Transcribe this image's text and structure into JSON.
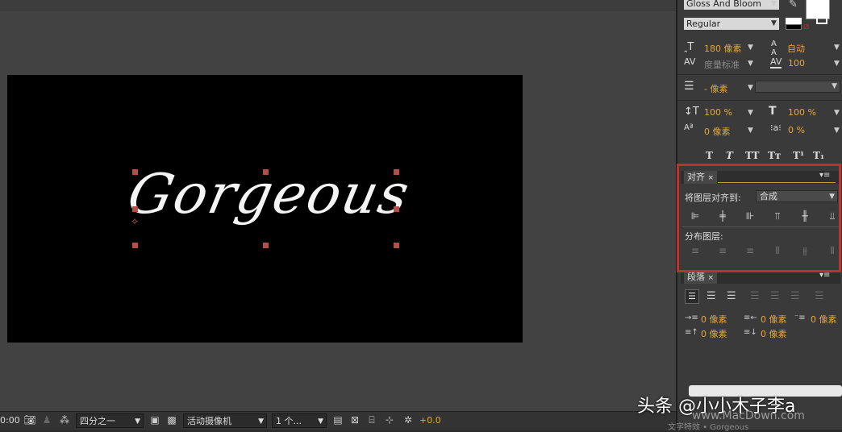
{
  "viewer": {
    "composition_text": "Gorgeous"
  },
  "bottombar": {
    "timecode": "0:00",
    "resolution": "四分之一",
    "camera": "活动摄像机",
    "views": "1 个...",
    "exposure": "+0.0"
  },
  "character": {
    "font_name": "Gloss And Bloom",
    "font_style": "Regular",
    "font_size": "180 像素",
    "leading": "自动",
    "kerning": "度量标准",
    "tracking": "100",
    "stroke_width": "- 像素",
    "vert_scale": "100 %",
    "horiz_scale": "100 %",
    "baseline_shift": "0 像素",
    "tsume": "0 %",
    "format_buttons": [
      "T",
      "T",
      "TT",
      "Tт",
      "T¹",
      "T₁"
    ]
  },
  "align_panel": {
    "tab_label": "对齐",
    "align_to_label": "将图层对齐到:",
    "align_to_value": "合成",
    "distribute_label": "分布图层:"
  },
  "paragraph_panel": {
    "tab_label": "段落",
    "indent_left": "0 像素",
    "indent_right": "0 像素",
    "indent_first": "0 像素",
    "space_before": "0 像素",
    "space_after": "0 像素"
  },
  "watermark": {
    "main": "头条 @小小木子李a",
    "url": "www.MacDown.com",
    "footer": "文字特效 • Gorgeous"
  },
  "colors": {
    "accent_orange": "#e6a63a",
    "highlight_red": "#c2302a",
    "handle": "#b0504a"
  }
}
